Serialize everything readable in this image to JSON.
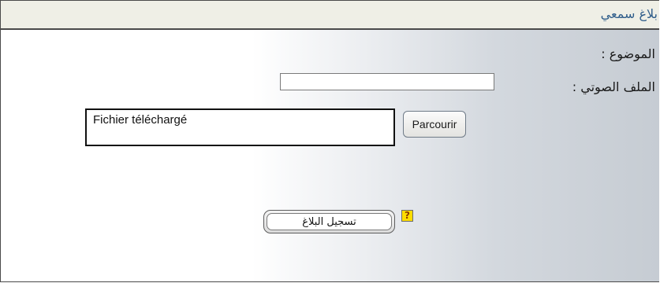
{
  "header": {
    "title": "بلاغ سمعي"
  },
  "form": {
    "subject": {
      "label": "الموضوع :",
      "value": ""
    },
    "audio_file": {
      "label": "الملف الصوتي :",
      "filename": "Fichier téléchargé",
      "browse_label": "Parcourir"
    },
    "help_icon": "question-mark-icon",
    "help_glyph": "?",
    "submit_label": "تسجيل البلاغ"
  },
  "colors": {
    "title_text": "#2f5d8a",
    "titlebar_bg": "#efefe6",
    "help_icon_bg": "#ffdd00"
  }
}
